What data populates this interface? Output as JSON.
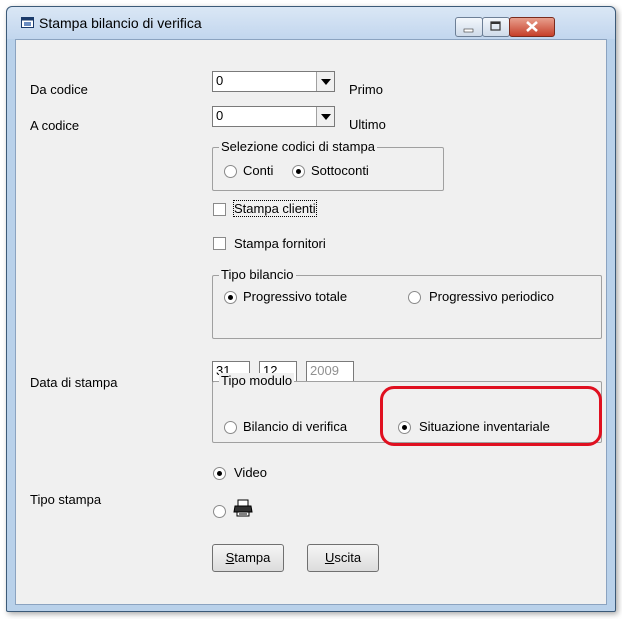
{
  "window": {
    "title": "Stampa bilancio di verifica"
  },
  "da_codice": {
    "label": "Da codice",
    "value": "0",
    "hint": "Primo"
  },
  "a_codice": {
    "label": "A codice",
    "value": "0",
    "hint": "Ultimo"
  },
  "selezione": {
    "legend": "Selezione codici di stampa",
    "options": [
      "Conti",
      "Sottoconti"
    ],
    "selected": "Sottoconti"
  },
  "stampa_clienti": {
    "label": "Stampa clienti",
    "checked": false
  },
  "stampa_fornitori": {
    "label": "Stampa fornitori",
    "checked": false
  },
  "tipo_bilancio": {
    "legend": "Tipo bilancio",
    "options": [
      "Progressivo totale",
      "Progressivo periodico"
    ],
    "selected": "Progressivo totale"
  },
  "data_stampa": {
    "label": "Data di stampa",
    "day": "31",
    "month": "12",
    "year": "2009"
  },
  "tipo_modulo": {
    "legend": "Tipo modulo",
    "options": [
      "Bilancio di verifica",
      "Situazione inventariale"
    ],
    "selected": "Situazione inventariale"
  },
  "tipo_stampa": {
    "label": "Tipo stampa",
    "options": [
      "Video",
      "printer-icon"
    ],
    "selected": "Video"
  },
  "buttons": {
    "stampa": {
      "first": "S",
      "rest": "tampa"
    },
    "uscita": {
      "first": "U",
      "rest": "scita"
    }
  },
  "colors": {
    "highlight": "#e01020",
    "titlebar": "#c2d6ee",
    "face": "#f0f0f0"
  }
}
